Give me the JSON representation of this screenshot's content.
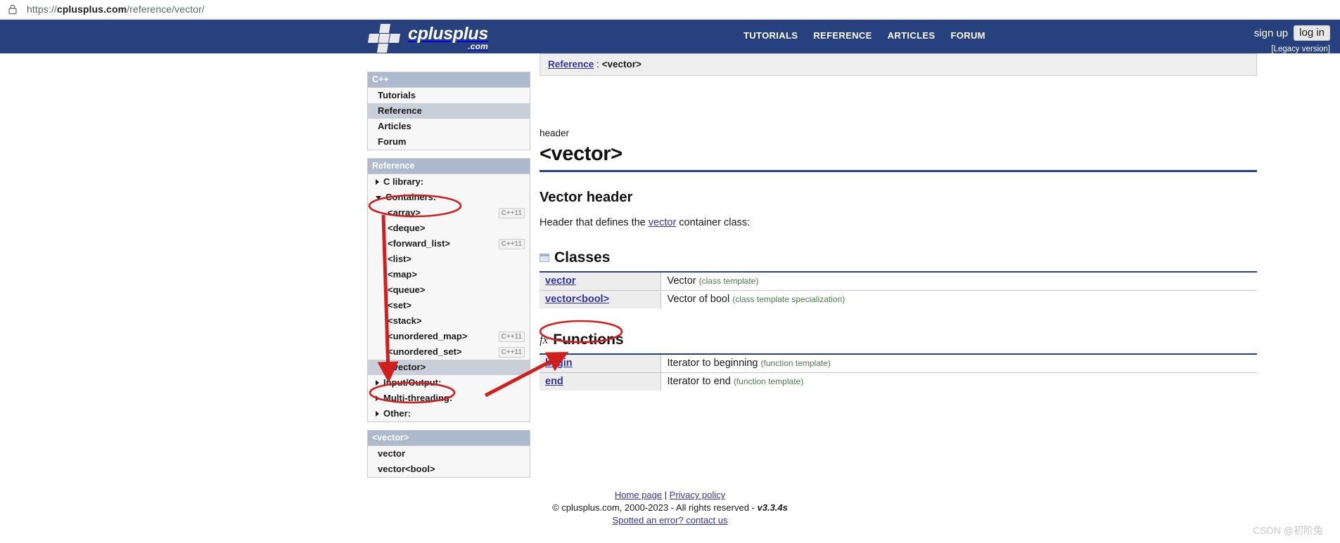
{
  "browser": {
    "lock_icon": "lock-icon",
    "url_prefix": "https://",
    "url_domain": "cplusplus.com",
    "url_path": "/reference/vector/",
    "url_full": "https://cplusplus.com/reference/vector/"
  },
  "header": {
    "logo_word_main": "cplusplus",
    "logo_word_sub": ".com",
    "nav": [
      {
        "label": "TUTORIALS"
      },
      {
        "label": "REFERENCE"
      },
      {
        "label": "ARTICLES"
      },
      {
        "label": "FORUM"
      }
    ],
    "sign_up": "sign up",
    "log_in": "log in",
    "legacy": "[Legacy version]",
    "bg_color": "#27417e"
  },
  "sidebar": {
    "cpp_panel": {
      "title": "C++",
      "items": [
        {
          "label": "Tutorials",
          "selected": false
        },
        {
          "label": "Reference",
          "selected": true
        },
        {
          "label": "Articles",
          "selected": false
        },
        {
          "label": "Forum",
          "selected": false
        }
      ]
    },
    "reference_panel": {
      "title": "Reference",
      "groups": [
        {
          "label": "C library:",
          "open": false
        },
        {
          "label": "Containers:",
          "open": true
        },
        {
          "label": "Input/Output:",
          "open": false
        },
        {
          "label": "Multi-threading:",
          "open": false
        },
        {
          "label": "Other:",
          "open": false
        }
      ],
      "containers": [
        {
          "label": "<array>",
          "badge": "C++11",
          "selected": false
        },
        {
          "label": "<deque>",
          "badge": "",
          "selected": false
        },
        {
          "label": "<forward_list>",
          "badge": "C++11",
          "selected": false
        },
        {
          "label": "<list>",
          "badge": "",
          "selected": false
        },
        {
          "label": "<map>",
          "badge": "",
          "selected": false
        },
        {
          "label": "<queue>",
          "badge": "",
          "selected": false
        },
        {
          "label": "<set>",
          "badge": "",
          "selected": false
        },
        {
          "label": "<stack>",
          "badge": "",
          "selected": false
        },
        {
          "label": "<unordered_map>",
          "badge": "C++11",
          "selected": false
        },
        {
          "label": "<unordered_set>",
          "badge": "C++11",
          "selected": false
        },
        {
          "label": "<vector>",
          "badge": "",
          "selected": true
        }
      ]
    },
    "vector_panel": {
      "title": "<vector>",
      "items": [
        {
          "label": "vector"
        },
        {
          "label": "vector<bool>"
        }
      ]
    }
  },
  "main": {
    "breadcrumb_root": "Reference",
    "breadcrumb_sep": " : ",
    "breadcrumb_current": "<vector>",
    "kicker": "header",
    "title": "<vector>",
    "section_heading": "Vector header",
    "desc_before": "Header that defines the ",
    "desc_link": "vector",
    "desc_after": " container class:",
    "classes": {
      "icon": "classes-icon",
      "heading": "Classes",
      "rows": [
        {
          "name": "vector",
          "desc": "Vector",
          "note": "(class template)"
        },
        {
          "name": "vector<bool>",
          "desc": "Vector of bool",
          "note": "(class template specialization)"
        }
      ]
    },
    "functions": {
      "icon": "fx-icon",
      "heading": "Functions",
      "rows": [
        {
          "name": "begin",
          "desc": "Iterator to beginning",
          "note": "(function template)"
        },
        {
          "name": "end",
          "desc": "Iterator to end",
          "note": "(function template)"
        }
      ]
    }
  },
  "footer": {
    "home_page": "Home page",
    "pipe": " | ",
    "privacy": "Privacy policy",
    "copyright": "© cplusplus.com, 2000-2023 - All rights reserved - ",
    "version": "v3.3.4s",
    "error_link": "Spotted an error? contact us"
  },
  "watermark": "CSDN @初阶兔",
  "annotations": {
    "color": "#d01f1f",
    "ellipse_containers": "ellipse-around-containers",
    "ellipse_vector_item": "ellipse-around-vector-sidebar-item",
    "ellipse_vector_class": "ellipse-around-vector-class-link",
    "arrow_down": "arrow-containers-to-vector",
    "arrow_diagonal": "arrow-vector-item-to-vector-class"
  }
}
